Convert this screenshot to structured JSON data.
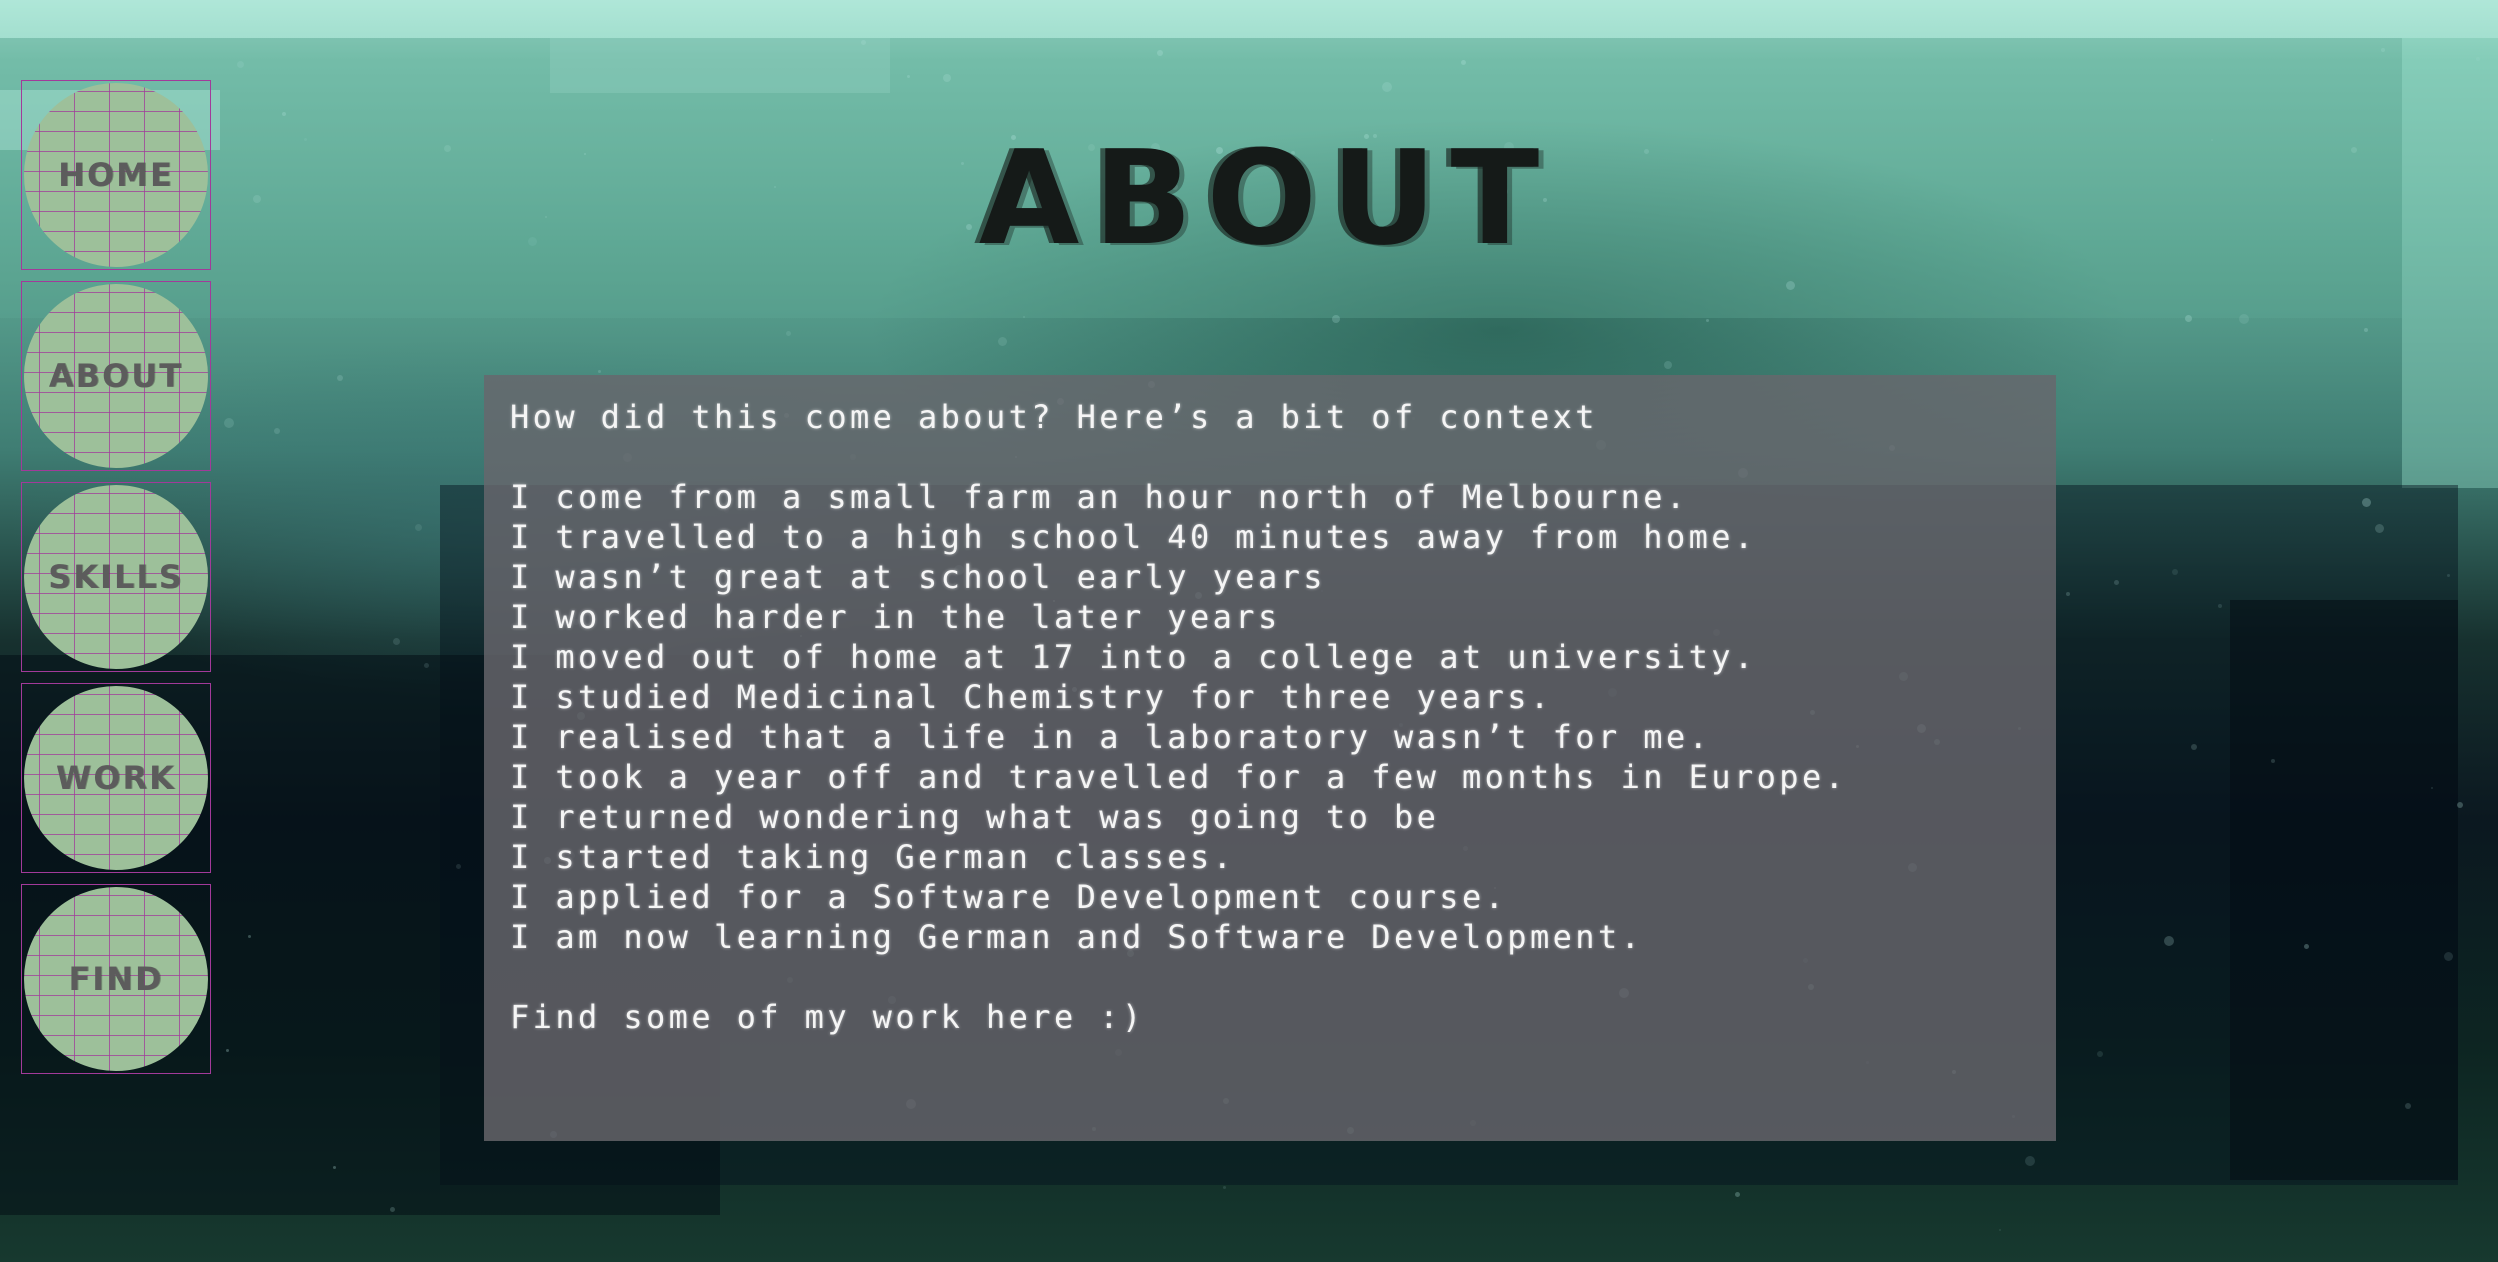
{
  "nav": {
    "items": [
      {
        "label": "HOME"
      },
      {
        "label": "ABOUT"
      },
      {
        "label": "SKILLS"
      },
      {
        "label": "WORK"
      },
      {
        "label": "FIND"
      }
    ]
  },
  "page": {
    "title": "ABOUT"
  },
  "content": {
    "intro": "How did this come about? Here’s a bit of context",
    "lines": [
      "I come from a small farm an hour north of Melbourne.",
      "I travelled to a high school 40 minutes away from home.",
      "I wasn’t great at school early years",
      "I worked harder in the later years",
      "I moved out of home at 17 into a college at university.",
      "I studied Medicinal Chemistry for three years.",
      "I realised that a life in a laboratory wasn’t for me.",
      "I took a year off and travelled for a few months in Europe.",
      "I returned wondering what was going to be",
      "I started taking German classes.",
      "I applied for a Software Development course.",
      "I am now learning German and Software Development."
    ],
    "outro": "Find some of my work here :)"
  },
  "colors": {
    "nav_fill": "#9dc09a",
    "nav_grid": "#a23a9a",
    "panel": "#68666c",
    "title": "#151a18"
  }
}
